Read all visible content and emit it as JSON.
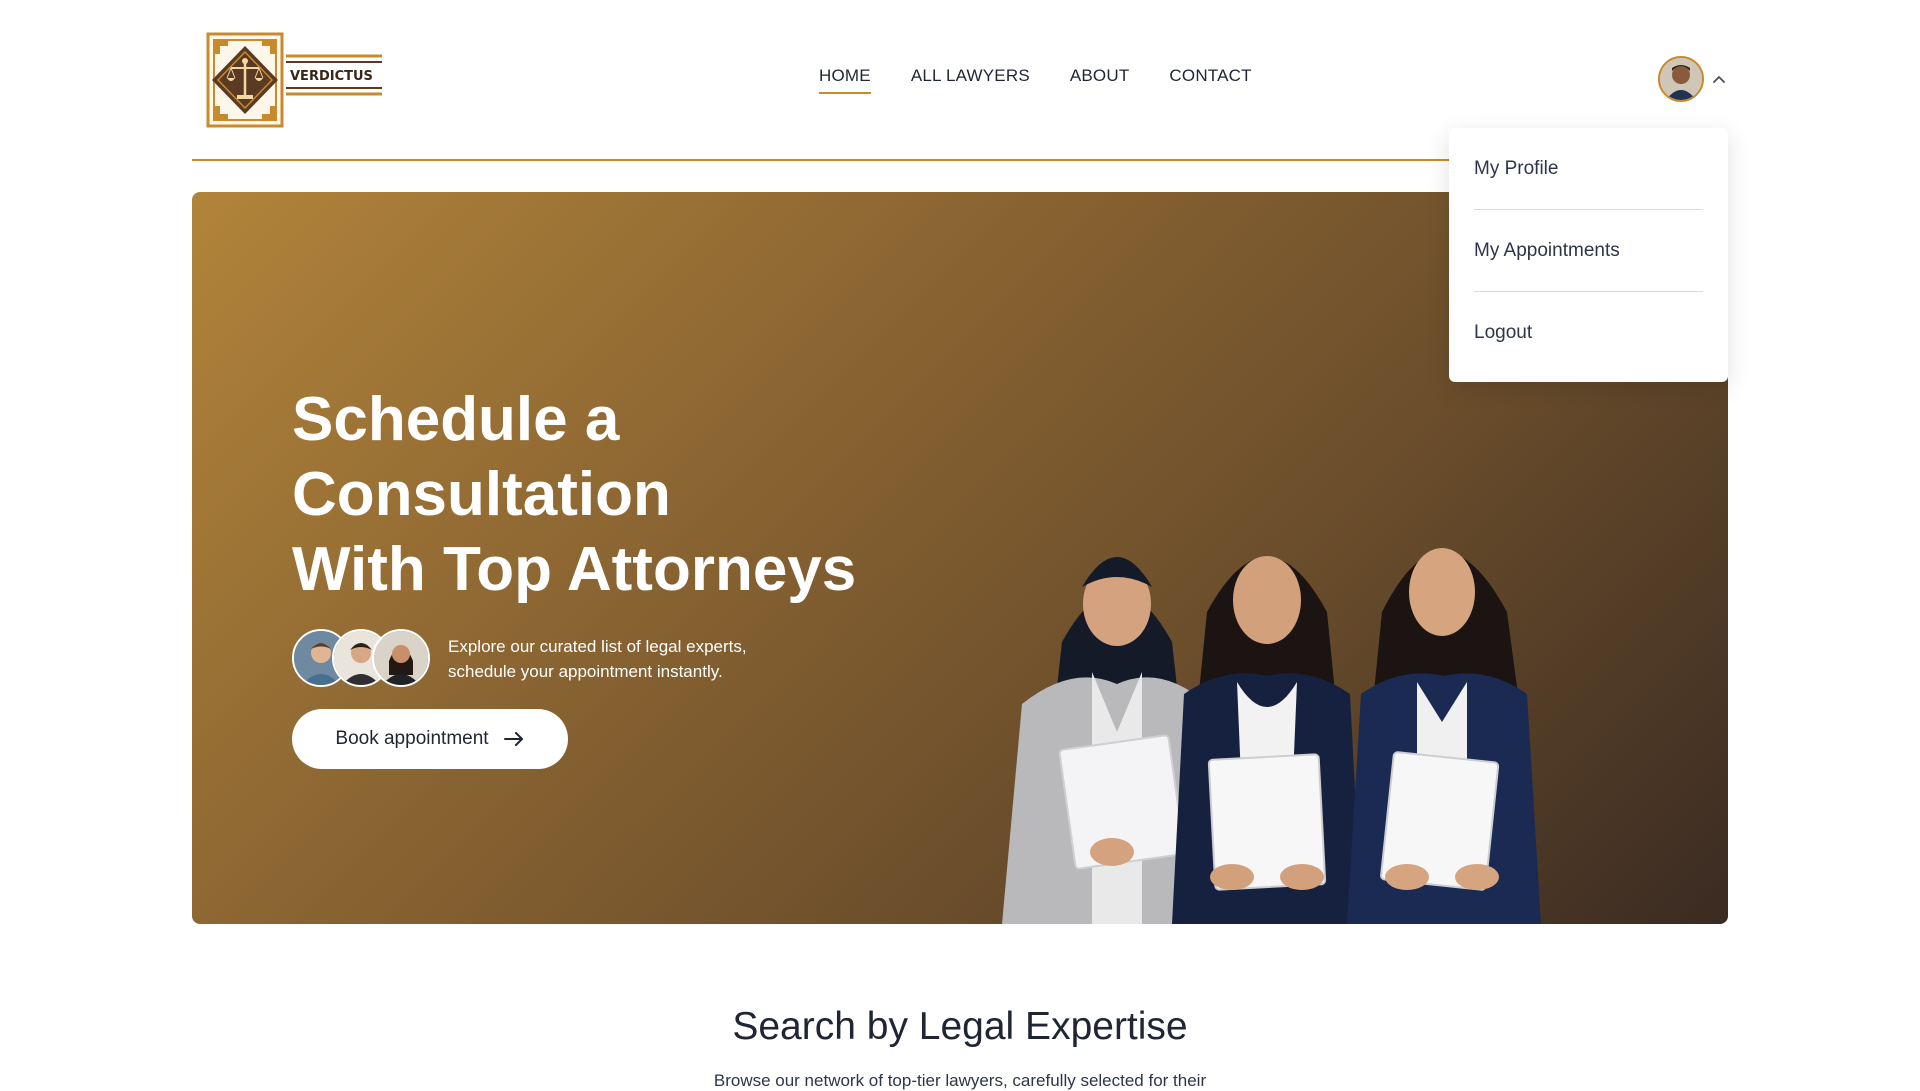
{
  "brand": {
    "name": "VERDICTUS",
    "logo_icon": "scales-of-justice-icon",
    "accent_color": "#c98a2e",
    "dark_color": "#5a3a22"
  },
  "nav": {
    "links": [
      {
        "label": "HOME",
        "active": true
      },
      {
        "label": "ALL LAWYERS",
        "active": false
      },
      {
        "label": "ABOUT",
        "active": false
      },
      {
        "label": "CONTACT",
        "active": false
      }
    ],
    "profile_chevron": "chevron-up-icon"
  },
  "dropdown": {
    "items": [
      "My Profile",
      "My Appointments",
      "Logout"
    ]
  },
  "hero": {
    "title_lines": [
      "Schedule a",
      "Consultation",
      "With Top Attorneys"
    ],
    "description_lines": [
      "Explore our curated list of legal experts,",
      "schedule your appointment instantly."
    ],
    "button_label": "Book appointment",
    "button_icon": "arrow-right-icon",
    "gradient": [
      "#b2843a",
      "#3a2b22"
    ]
  },
  "section": {
    "title": "Search by Legal Expertise",
    "subtitle": "Browse our network of top-tier lawyers, carefully selected for their"
  }
}
